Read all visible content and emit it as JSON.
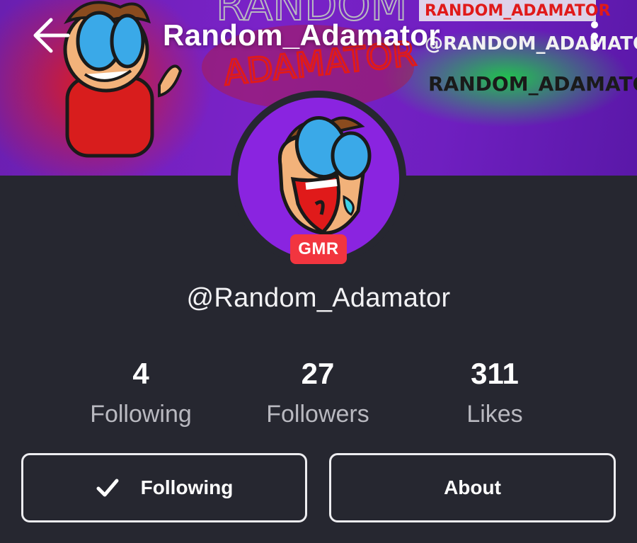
{
  "app": {
    "title": "Random_Adamator"
  },
  "banner": {
    "art_lines": [
      "RANDOM",
      "ADAMATOR",
      "RANDOM_ADAMATOR",
      "@RANDOM_ADAMATOR",
      "RANDOM_ADAMATOR"
    ],
    "colors": {
      "purple": "#7a22c8",
      "red": "#e01a1a",
      "green": "#1ec94a"
    }
  },
  "profile": {
    "badge": "GMR",
    "handle": "@Random_Adamator"
  },
  "stats": [
    {
      "value": "4",
      "label": "Following"
    },
    {
      "value": "27",
      "label": "Followers"
    },
    {
      "value": "311",
      "label": "Likes"
    }
  ],
  "actions": {
    "following_label": "Following",
    "about_label": "About"
  },
  "icons": {
    "back": "arrow-left-icon",
    "menu": "more-vertical-icon",
    "check": "check-icon"
  },
  "theme": {
    "background": "#262730",
    "badge_red": "#f2353f",
    "muted_text": "#b9b9c0"
  }
}
